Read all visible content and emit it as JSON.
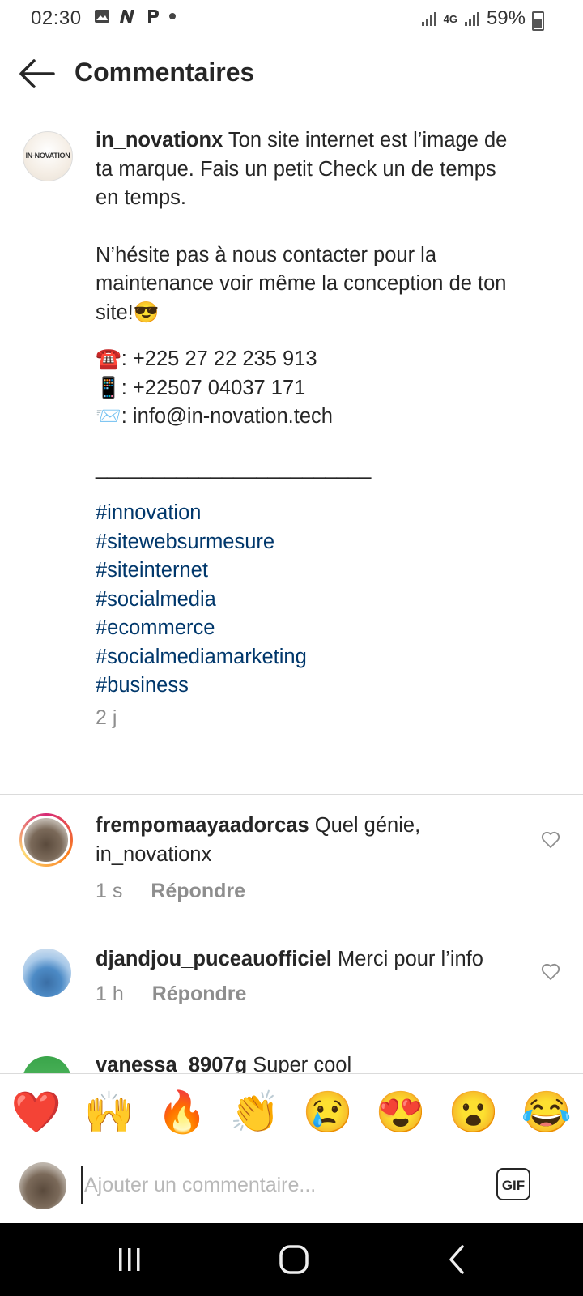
{
  "status_bar": {
    "time": "02:30",
    "network": "4G",
    "battery": "59%"
  },
  "header": {
    "title": "Commentaires"
  },
  "caption": {
    "username": "in_novationx",
    "avatar_logo_text": "IN-NOVATION",
    "line1": "Ton site internet est l’image de ta marque. Fais un petit Check un de temps en temps.",
    "line2": "N’hésite pas à nous contacter pour la maintenance voir même la conception de ton site!😎",
    "phone": "☎️: +225 27 22 235 913",
    "mobile": "📱: +22507 04037 171",
    "email": "📨: info@in-novation.tech",
    "separator": "________________________",
    "hashtags": [
      "#innovation",
      "#sitewebsurmesure",
      "#siteinternet",
      "#socialmedia",
      "#ecommerce",
      "#socialmediamarketing",
      "#business"
    ],
    "time": "2 j"
  },
  "comments": [
    {
      "username": "frempomaayaadorcas",
      "text": "Quel génie, in_novationx",
      "time": "1 s",
      "reply": "Répondre"
    },
    {
      "username": "djandjou_puceauofficiel",
      "text": "Merci pour l’info",
      "time": "1 h",
      "reply": "Répondre"
    },
    {
      "username": "vanessa_8907g",
      "text": "Super cool"
    }
  ],
  "reactions": [
    "❤️",
    "🙌",
    "🔥",
    "👏",
    "😢",
    "😍",
    "😮",
    "😂"
  ],
  "composer": {
    "placeholder": "Ajouter un commentaire...",
    "gif_label": "GIF"
  }
}
